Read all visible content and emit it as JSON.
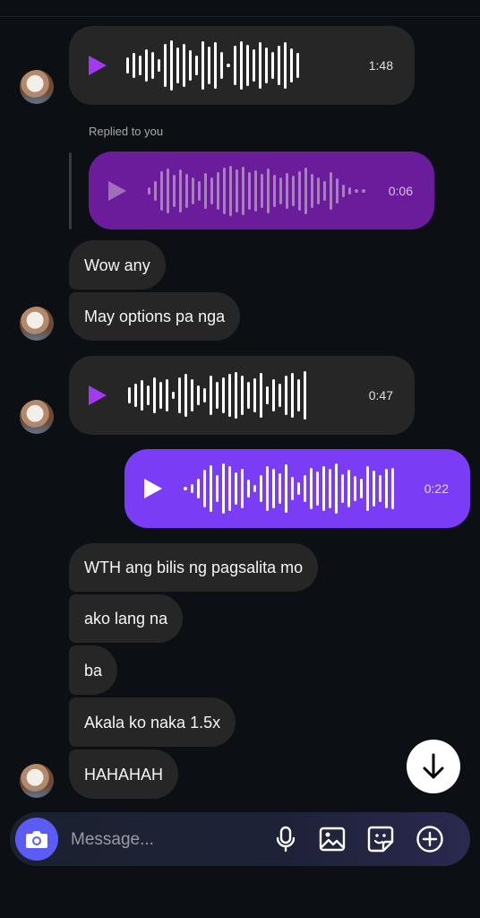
{
  "composer": {
    "placeholder": "Message..."
  },
  "replied_label": "Replied to you",
  "voice_messages": {
    "first": {
      "duration": "1:48"
    },
    "reply": {
      "duration": "0:06"
    },
    "second": {
      "duration": "0:47"
    },
    "mine": {
      "duration": "0:22"
    }
  },
  "messages": {
    "m1": "Wow any",
    "m2": "May options pa nga",
    "m3": "WTH ang bilis ng pagsalita mo",
    "m4": "ako lang na",
    "m5": "ba",
    "m6": "Akala ko naka 1.5x",
    "m7": "HAHAHAH"
  },
  "colors": {
    "background": "#0c1014",
    "incoming_bubble": "#262626",
    "outgoing_voice": "#7a3cf5",
    "reply_voice": "#6a1c9a",
    "camera_button": "#5b5cf6",
    "play_icon": "#a33af2"
  },
  "icons": {
    "play": "play-icon",
    "camera": "camera-icon",
    "mic": "microphone-icon",
    "gallery": "image-icon",
    "sticker": "sticker-icon",
    "add": "plus-circle-icon",
    "scroll": "arrow-down-icon"
  }
}
